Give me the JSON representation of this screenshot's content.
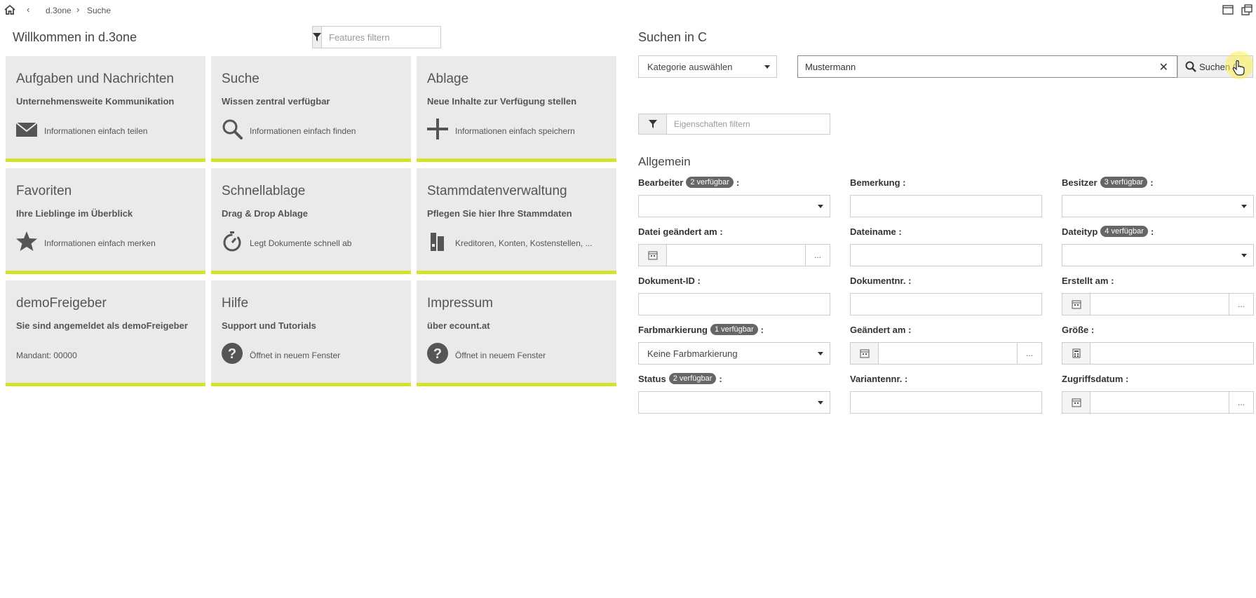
{
  "breadcrumb": {
    "back": "‹",
    "items": [
      "d.3one",
      "Suche"
    ],
    "separator": "›"
  },
  "welcome": {
    "title": "Willkommen in d.3one",
    "filter_placeholder": "Features filtern"
  },
  "tiles": [
    {
      "title": "Aufgaben und Nachrichten",
      "subtitle": "Unternehmensweite Kommunikation",
      "icon": "mail-icon",
      "link": "Informationen einfach teilen"
    },
    {
      "title": "Suche",
      "subtitle": "Wissen zentral verfügbar",
      "icon": "search-icon",
      "link": "Informationen einfach finden"
    },
    {
      "title": "Ablage",
      "subtitle": "Neue Inhalte zur Verfügung stellen",
      "icon": "plus-icon",
      "link": "Informationen einfach speichern"
    },
    {
      "title": "Favoriten",
      "subtitle": "Ihre Lieblinge im Überblick",
      "icon": "star-icon",
      "link": "Informationen einfach merken"
    },
    {
      "title": "Schnellablage",
      "subtitle": "Drag & Drop Ablage",
      "icon": "stopwatch-icon",
      "link": "Legt Dokumente schnell ab"
    },
    {
      "title": "Stammdatenverwaltung",
      "subtitle": "Pflegen Sie hier Ihre Stammdaten",
      "icon": "binder-icon",
      "link": "Kreditoren, Konten, Kostenstellen, ..."
    },
    {
      "title": "demoFreigeber",
      "subtitle": "Sie sind angemeldet als demoFreigeber",
      "icon": "",
      "link": "Mandant: 00000"
    },
    {
      "title": "Hilfe",
      "subtitle": "Support und Tutorials",
      "icon": "help-icon",
      "link": "Öffnet in neuem Fenster"
    },
    {
      "title": "Impressum",
      "subtitle": "über ecount.at",
      "icon": "help-icon",
      "link": "Öffnet in neuem Fenster"
    }
  ],
  "search": {
    "title": "Suchen in C",
    "category": "Kategorie auswählen",
    "query": "Mustermann",
    "button": "Suchen (",
    "property_filter_placeholder": "Eigenschaften filtern",
    "section": "Allgemein"
  },
  "fields": [
    {
      "label": "Bearbeiter",
      "badge": "2 verfügbar",
      "type": "select",
      "value": ""
    },
    {
      "label": "Bemerkung",
      "badge": "",
      "type": "text",
      "value": ""
    },
    {
      "label": "Besitzer",
      "badge": "3 verfügbar",
      "type": "select",
      "value": ""
    },
    {
      "label": "Datei geändert am",
      "badge": "",
      "type": "date",
      "value": ""
    },
    {
      "label": "Dateiname",
      "badge": "",
      "type": "text",
      "value": ""
    },
    {
      "label": "Dateityp",
      "badge": "4 verfügbar",
      "type": "select",
      "value": ""
    },
    {
      "label": "Dokument-ID",
      "badge": "",
      "type": "text",
      "value": ""
    },
    {
      "label": "Dokumentnr.",
      "badge": "",
      "type": "text",
      "value": ""
    },
    {
      "label": "Erstellt am",
      "badge": "",
      "type": "date",
      "value": ""
    },
    {
      "label": "Farbmarkierung",
      "badge": "1 verfügbar",
      "type": "select",
      "value": "Keine Farbmarkierung"
    },
    {
      "label": "Geändert am",
      "badge": "",
      "type": "date",
      "value": ""
    },
    {
      "label": "Größe",
      "badge": "",
      "type": "number",
      "value": ""
    },
    {
      "label": "Status",
      "badge": "2 verfügbar",
      "type": "select",
      "value": ""
    },
    {
      "label": "Variantennr.",
      "badge": "",
      "type": "text",
      "value": ""
    },
    {
      "label": "Zugriffsdatum",
      "badge": "",
      "type": "date",
      "value": ""
    }
  ],
  "colors": {
    "tile_bg": "#ebeaea",
    "tile_accent": "#d6e32c",
    "badge": "#666666"
  }
}
